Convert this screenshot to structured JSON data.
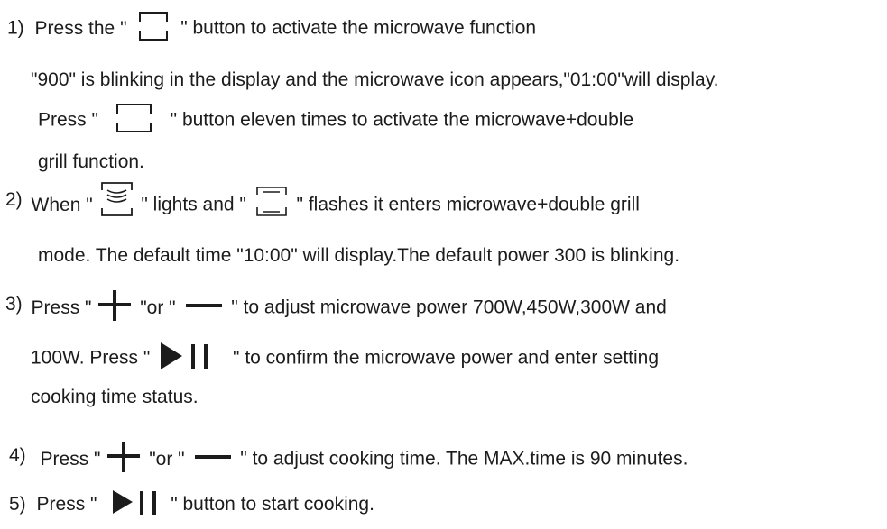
{
  "step1": {
    "num": "1)",
    "pre": "Press the \"",
    "post": "\" button to activate the microwave function",
    "line2": "\"900\" is blinking in the display and the microwave icon appears,\"01:00\"will display.",
    "line3_pre": "Press \"",
    "line3_post": "\" button eleven times to activate the microwave+double",
    "line4": "grill function."
  },
  "step2": {
    "num": "2)",
    "pre": "When \"",
    "mid": "\" lights and \"",
    "post": "\" flashes it enters  microwave+double  grill",
    "line2": "mode. The default time  \"10:00\" will display.The default power 300 is blinking."
  },
  "step3": {
    "num": "3)",
    "pre": "Press \"",
    "mid": "\"or \"",
    "post": "\" to adjust microwave power 700W,450W,300W and",
    "line2_pre": "100W.  Press \"",
    "line2_post": "\"  to confirm the microwave power and enter setting",
    "line3": "cooking time status."
  },
  "step4": {
    "num": "4)",
    "pre": "Press \"",
    "mid": "\"or \"",
    "post": "\" to adjust cooking time. The MAX.time is 90 minutes."
  },
  "step5": {
    "num": "5)",
    "pre": "Press \"",
    "post": "\" button to start cooking."
  },
  "icons": {
    "microwave": "microwave-button-icon",
    "grill": "grill-icon",
    "double_grill": "double-grill-icon",
    "plus": "plus-icon",
    "minus": "minus-icon",
    "start_pause": "start-pause-icon"
  }
}
